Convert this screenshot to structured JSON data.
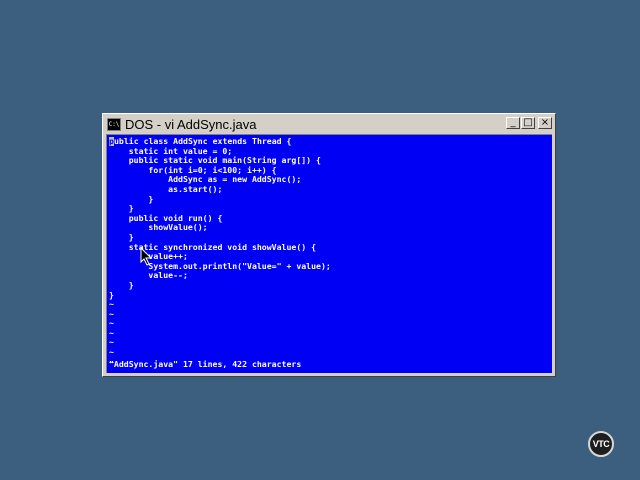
{
  "window": {
    "title": "DOS - vi AddSync.java",
    "icon_text": "C:\\",
    "controls": {
      "minimize": "_",
      "maximize": "□",
      "close": "×"
    }
  },
  "editor": {
    "first_char": "p",
    "lines": [
      "ublic class AddSync extends Thread {",
      "    static int value = 0;",
      "    public static void main(String arg[]) {",
      "        for(int i=0; i<100; i++) {",
      "            AddSync as = new AddSync();",
      "            as.start();",
      "        }",
      "    }",
      "    public void run() {",
      "        showValue();",
      "    }",
      "    static synchronized void showValue() {",
      "        value++;",
      "        System.out.println(\"Value=\" + value);",
      "        value--;",
      "    }",
      "}",
      "~",
      "~",
      "~",
      "~",
      "~",
      "~",
      "~"
    ],
    "status": "\"AddSync.java\" 17 lines, 422 characters"
  },
  "logo": {
    "text": "VTC"
  }
}
